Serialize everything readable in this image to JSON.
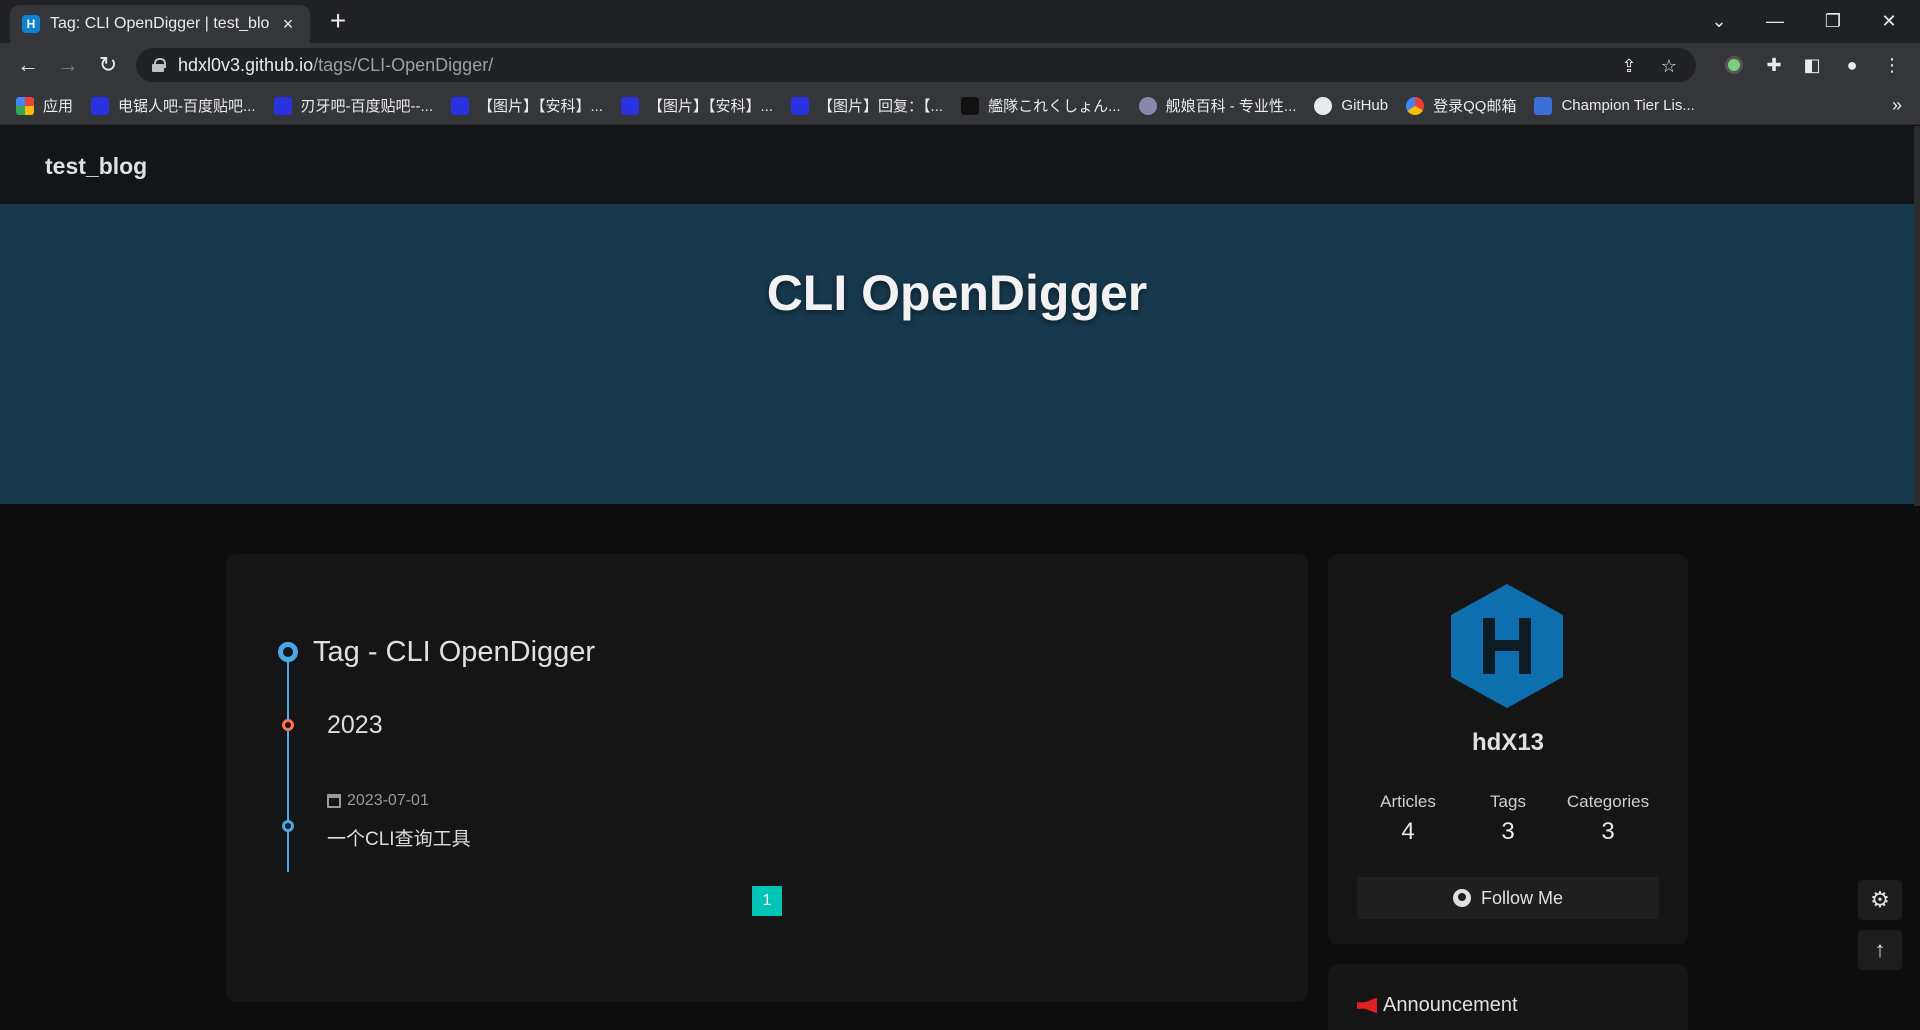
{
  "browser": {
    "tab_title": "Tag: CLI OpenDigger | test_blog",
    "tab_favicon_letter": "H",
    "url_host": "hdxl0v3.github.io",
    "url_path": "/tags/CLI-OpenDigger/",
    "bookmarks": [
      {
        "label": "应用",
        "icon_color": "#e8453c"
      },
      {
        "label": "电锯人吧-百度贴吧...",
        "icon_color": "#2932e1"
      },
      {
        "label": "刃牙吧-百度贴吧--...",
        "icon_color": "#2932e1"
      },
      {
        "label": "【图片】【安科】...",
        "icon_color": "#2932e1"
      },
      {
        "label": "【图片】【安科】...",
        "icon_color": "#2932e1"
      },
      {
        "label": "【图片】回复：【...",
        "icon_color": "#2932e1"
      },
      {
        "label": "艦隊これくしょん...",
        "icon_color": "#111111"
      },
      {
        "label": "舰娘百科 - 专业性...",
        "icon_color": "#8888aa"
      },
      {
        "label": "GitHub",
        "icon_color": "#e8eaed"
      },
      {
        "label": "登录QQ邮箱",
        "icon_color": "#f4b400"
      },
      {
        "label": "Champion Tier Lis...",
        "icon_color": "#3b6fd6"
      }
    ]
  },
  "blog": {
    "site_name": "test_blog",
    "page_title": "CLI OpenDigger",
    "tag_heading": "Tag - CLI OpenDigger",
    "year": "2023",
    "post": {
      "date": "2023-07-01",
      "title": "一个CLI查询工具"
    },
    "pagination": [
      "1"
    ]
  },
  "aside": {
    "avatar_letter": "H",
    "author": "hdX13",
    "stats": [
      {
        "label": "Articles",
        "value": "4"
      },
      {
        "label": "Tags",
        "value": "3"
      },
      {
        "label": "Categories",
        "value": "3"
      }
    ],
    "follow_label": "Follow Me",
    "announcement_label": "Announcement"
  },
  "colors": {
    "header_bg": "#17384d",
    "timeline_accent": "#4aa7e8",
    "year_dot": "#ff7242",
    "page_active": "#00c4b6",
    "avatar_blue": "#0e6fae"
  }
}
